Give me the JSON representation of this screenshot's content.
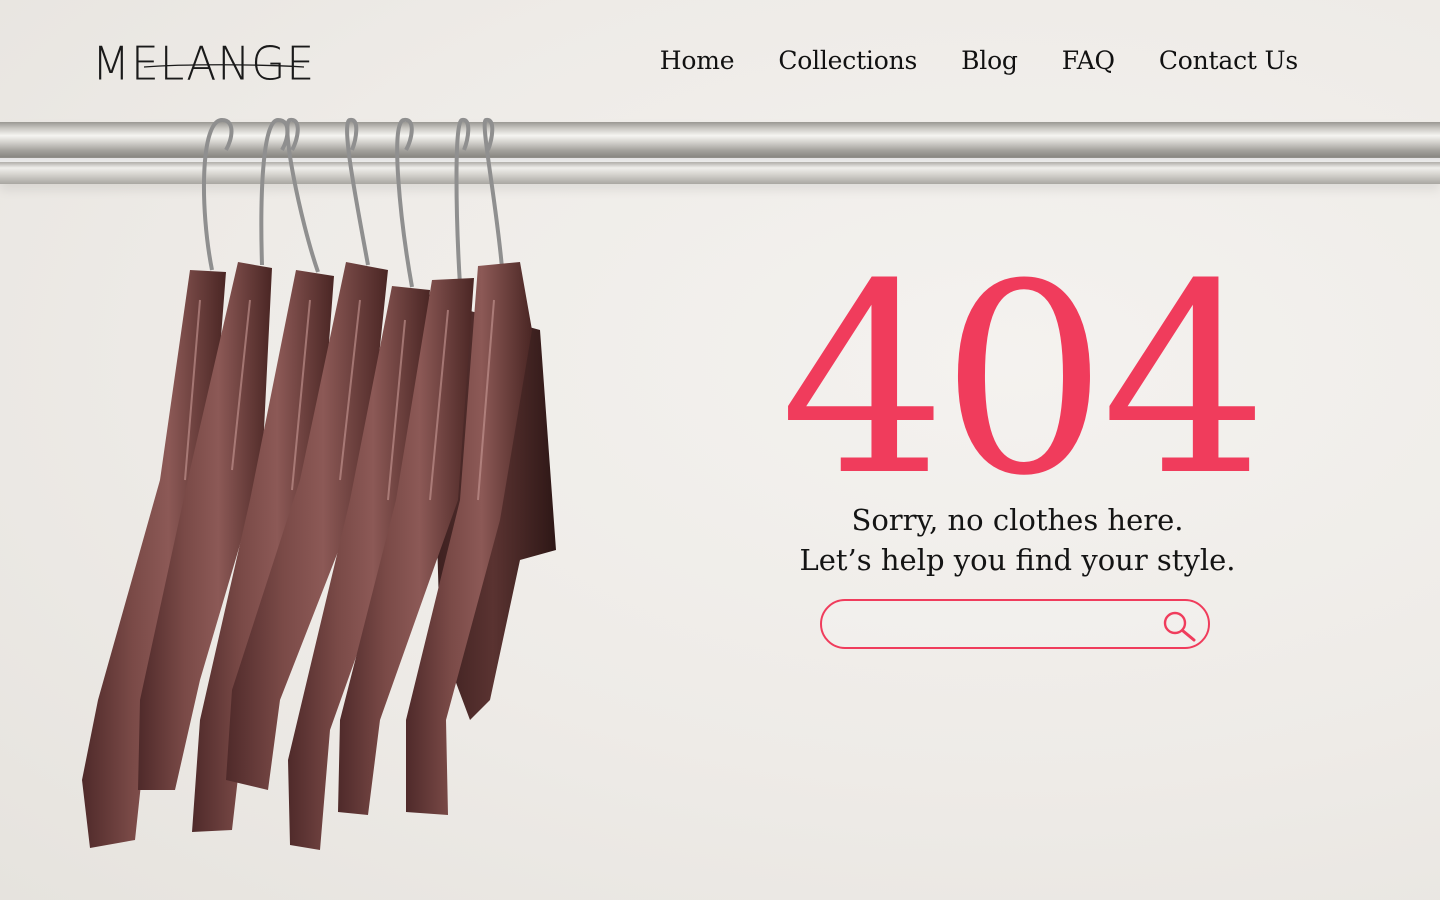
{
  "header": {
    "logo_text": "MELANGE",
    "nav": [
      "Home",
      "Collections",
      "Blog",
      "FAQ",
      "Contact Us"
    ]
  },
  "error": {
    "code": "404",
    "line1": "Sorry, no clothes here.",
    "line2": "Let’s help you find your style."
  },
  "search": {
    "placeholder": "",
    "icon": "search-icon"
  },
  "colors": {
    "accent": "#f03c5c",
    "background": "#efedea",
    "hanger": "#6b3a38"
  }
}
